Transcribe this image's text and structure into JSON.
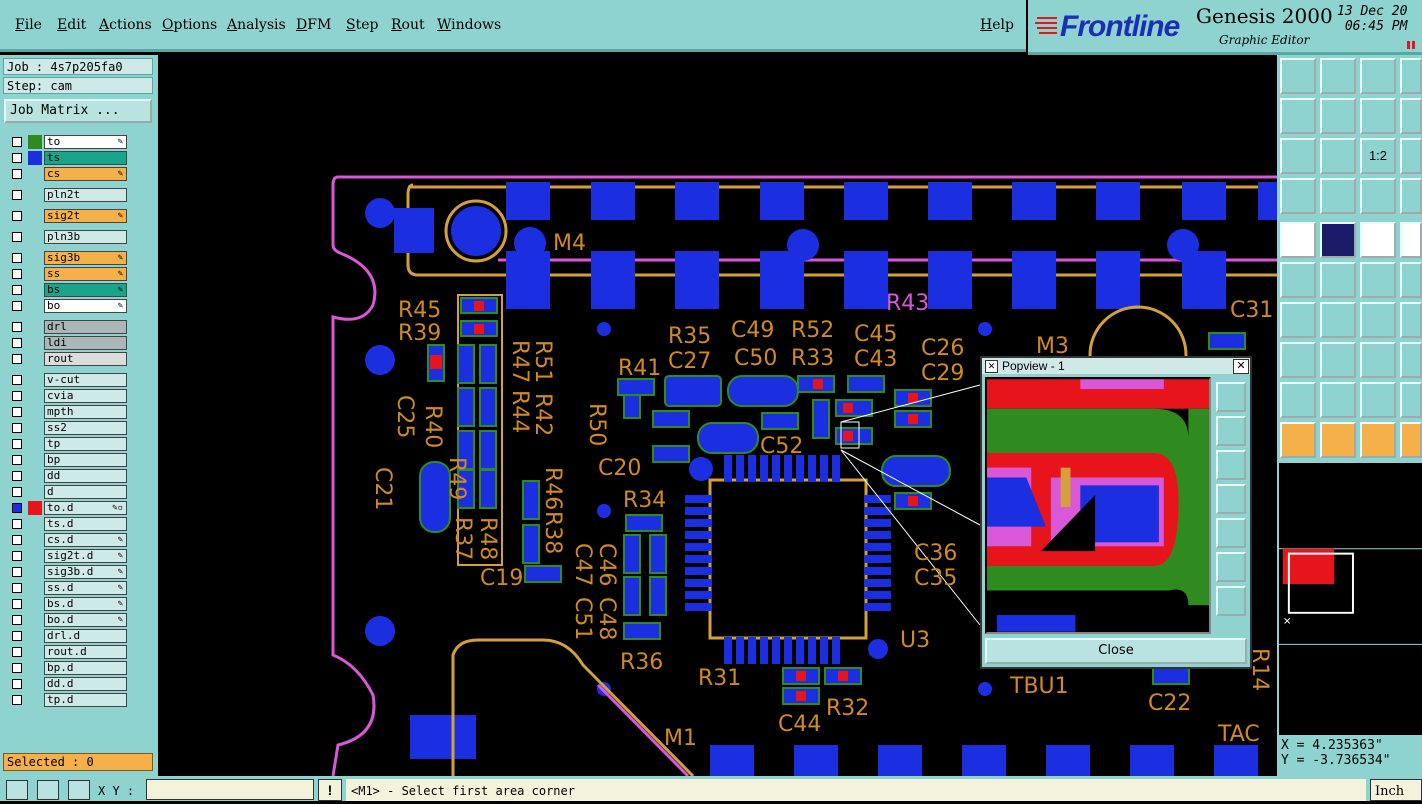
{
  "menu": [
    "File",
    "Edit",
    "Actions",
    "Options",
    "Analysis",
    "DFM",
    "Step",
    "Rout",
    "Windows"
  ],
  "help": "Help",
  "brand": {
    "logo": "Frontline",
    "app_name": "Genesis 2000",
    "subtitle": "Graphic Editor",
    "date": "13 Dec 20\n 06:45 PM"
  },
  "job": "Job : 4s7p205fa0",
  "step": "Step: cam",
  "job_matrix": "Job Matrix ...",
  "layers": [
    {
      "name": "to",
      "swatch": "#2f8a1f",
      "bg": "#ffffff",
      "flag": "✎"
    },
    {
      "name": "ts",
      "swatch": "#1b2fe0",
      "bg": "#1aa48a",
      "flag": ""
    },
    {
      "name": "cs",
      "swatch": "",
      "bg": "#f5b04a",
      "flag": "✎"
    },
    {
      "name": "pln2t",
      "swatch": "",
      "bg": "#cfe9e7",
      "flag": ""
    },
    {
      "name": "sig2t",
      "swatch": "",
      "bg": "#f5b04a",
      "flag": "✎"
    },
    {
      "name": "pln3b",
      "swatch": "",
      "bg": "#cfe9e7",
      "flag": ""
    },
    {
      "name": "sig3b",
      "swatch": "",
      "bg": "#f5b04a",
      "flag": "✎"
    },
    {
      "name": "ss",
      "swatch": "",
      "bg": "#f5b04a",
      "flag": "✎"
    },
    {
      "name": "bs",
      "swatch": "",
      "bg": "#1aa48a",
      "flag": "✎"
    },
    {
      "name": "bo",
      "swatch": "",
      "bg": "#ffffff",
      "flag": "✎"
    },
    {
      "name": "drl",
      "swatch": "",
      "bg": "#a9b7b7",
      "flag": ""
    },
    {
      "name": "ldi",
      "swatch": "",
      "bg": "#a9b7b7",
      "flag": ""
    },
    {
      "name": "rout",
      "swatch": "",
      "bg": "#dcdcdc",
      "flag": ""
    },
    {
      "name": "v-cut",
      "swatch": "",
      "bg": "#cfe9e7",
      "flag": ""
    },
    {
      "name": "cvia",
      "swatch": "",
      "bg": "#cfe9e7",
      "flag": ""
    },
    {
      "name": "mpth",
      "swatch": "",
      "bg": "#cfe9e7",
      "flag": ""
    },
    {
      "name": "ss2",
      "swatch": "",
      "bg": "#cfe9e7",
      "flag": ""
    },
    {
      "name": "tp",
      "swatch": "",
      "bg": "#cfe9e7",
      "flag": ""
    },
    {
      "name": "bp",
      "swatch": "",
      "bg": "#cfe9e7",
      "flag": ""
    },
    {
      "name": "dd",
      "swatch": "",
      "bg": "#cfe9e7",
      "flag": ""
    },
    {
      "name": "d",
      "swatch": "",
      "bg": "#cfe9e7",
      "flag": ""
    },
    {
      "name": "to.d",
      "swatch": "#e8141c",
      "bg": "#cfe9e7",
      "flag": "✎▫"
    },
    {
      "name": "ts.d",
      "swatch": "",
      "bg": "#cfe9e7",
      "flag": ""
    },
    {
      "name": "cs.d",
      "swatch": "",
      "bg": "#cfe9e7",
      "flag": "✎"
    },
    {
      "name": "sig2t.d",
      "swatch": "",
      "bg": "#cfe9e7",
      "flag": "✎"
    },
    {
      "name": "sig3b.d",
      "swatch": "",
      "bg": "#cfe9e7",
      "flag": "✎"
    },
    {
      "name": "ss.d",
      "swatch": "",
      "bg": "#cfe9e7",
      "flag": "✎"
    },
    {
      "name": "bs.d",
      "swatch": "",
      "bg": "#cfe9e7",
      "flag": "✎"
    },
    {
      "name": "bo.d",
      "swatch": "",
      "bg": "#cfe9e7",
      "flag": "✎"
    },
    {
      "name": "drl.d",
      "swatch": "",
      "bg": "#cfe9e7",
      "flag": ""
    },
    {
      "name": "rout.d",
      "swatch": "",
      "bg": "#cfe9e7",
      "flag": ""
    },
    {
      "name": "bp.d",
      "swatch": "",
      "bg": "#cfe9e7",
      "flag": ""
    },
    {
      "name": "dd.d",
      "swatch": "",
      "bg": "#cfe9e7",
      "flag": ""
    },
    {
      "name": "tp.d",
      "swatch": "",
      "bg": "#cfe9e7",
      "flag": ""
    }
  ],
  "selected": "Selected : 0",
  "xy_label": "X Y :",
  "xy_value": "",
  "warn": "!",
  "status": "<M1> - Select first area corner",
  "units": "Inch",
  "coords": {
    "x": "X = 4.235363\"",
    "y": "Y = -3.736534\""
  },
  "popview": {
    "title": "Popview - 1",
    "close": "Close"
  },
  "pcb_labels": [
    "M4",
    "R45",
    "R39",
    "C25",
    "R47",
    "R44",
    "R51",
    "R42",
    "R49",
    "R40",
    "C21",
    "R37",
    "R48",
    "R46",
    "R38",
    "C19",
    "R41",
    "R50",
    "C20",
    "R35",
    "C27",
    "C49",
    "C50",
    "C52",
    "R52",
    "R33",
    "C45",
    "C43",
    "C26",
    "C29",
    "R43",
    "C31",
    "M3",
    "R34",
    "C46",
    "C47",
    "C48",
    "C51",
    "R36",
    "R31",
    "C44",
    "R32",
    "C36",
    "C35",
    "U3",
    "TBU1",
    "C22",
    "M1",
    "TAC",
    "R14"
  ],
  "colors": {
    "panel": "#8ed3d0",
    "pad": "#1b2fe0",
    "outline": "#d4a03a",
    "trace": "#d858d8",
    "mask": "#e8141c",
    "silk": "#d08a20"
  }
}
